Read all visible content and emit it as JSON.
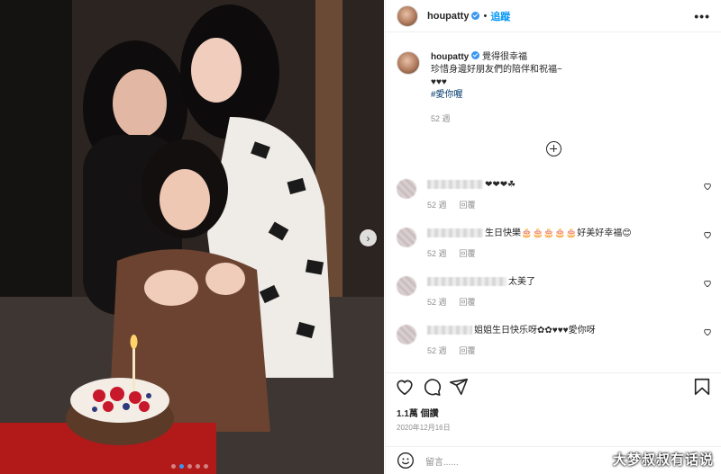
{
  "post": {
    "username": "houpatty",
    "follow_label": "追蹤",
    "separator": "•",
    "more_label": "•••",
    "caption": {
      "username": "houpatty",
      "line1": "覺得很幸福",
      "line2": "珍惜身邊好朋友們的陪伴和祝福~",
      "line3": "♥♥♥",
      "hashtag": "#愛你喔",
      "time": "52 週"
    },
    "likes": "1.1萬 個讚",
    "date": "2020年12月16日",
    "add_comment_placeholder": "留言......"
  },
  "comments": [
    {
      "text": "❤❤❤☘",
      "time": "52 週",
      "reply": "回覆"
    },
    {
      "text": "生日快樂🎂🎂🎂🎂🎂好美好幸福😊",
      "time": "52 週",
      "reply": "回覆"
    },
    {
      "text": "太美了",
      "time": "52 週",
      "reply": "回覆"
    },
    {
      "text": "姐姐生日快乐呀✿✿♥♥♥愛你呀",
      "time": "52 週",
      "reply": "回覆"
    }
  ],
  "photo": {
    "next_arrow": "›",
    "carousel_dots": 5,
    "active_dot": 2
  },
  "watermark": "大梦叔叔有话说",
  "colors": {
    "link_blue": "#0095f6",
    "hashtag": "#00376b",
    "verified": "#3897f0",
    "muted": "#8e8e8e"
  }
}
